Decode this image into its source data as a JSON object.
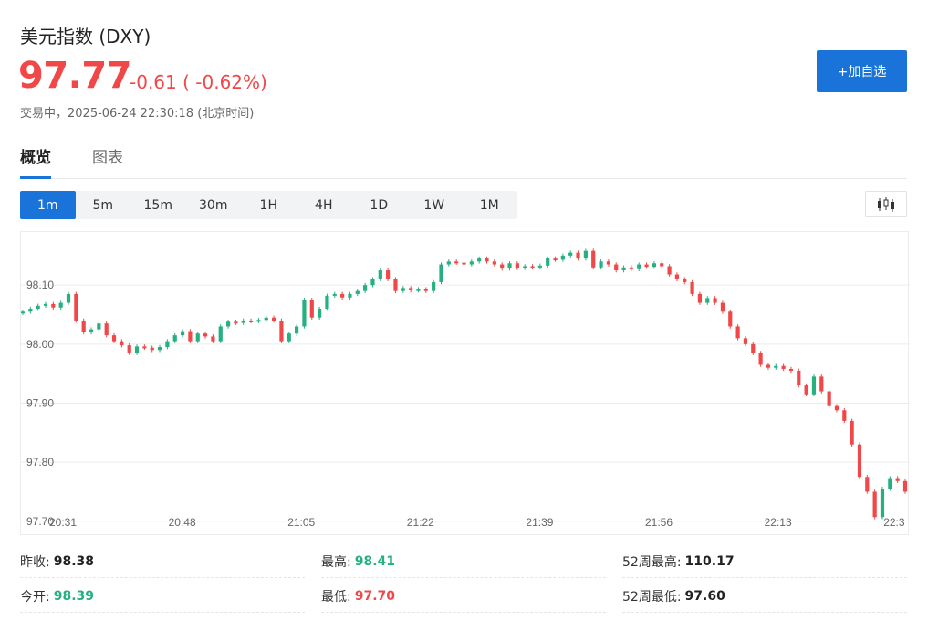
{
  "header": {
    "title": "美元指数 (DXY)",
    "price": "97.77",
    "change": "-0.61 ( -0.62%)",
    "status": "交易中，2025-06-24 22:30:18 (北京时间)",
    "add_watchlist_label": "+加自选"
  },
  "colors": {
    "up": "#26b07f",
    "down": "#f04848",
    "accent": "#1a73d9"
  },
  "tabs": [
    {
      "label": "概览",
      "active": true
    },
    {
      "label": "图表",
      "active": false
    }
  ],
  "intervals": [
    {
      "label": "1m",
      "active": true
    },
    {
      "label": "5m",
      "active": false
    },
    {
      "label": "15m",
      "active": false
    },
    {
      "label": "30m",
      "active": false
    },
    {
      "label": "1H",
      "active": false
    },
    {
      "label": "4H",
      "active": false
    },
    {
      "label": "1D",
      "active": false
    },
    {
      "label": "1W",
      "active": false
    },
    {
      "label": "1M",
      "active": false
    }
  ],
  "chart_type_icon": "candlestick-icon",
  "chart_data": {
    "type": "candlestick",
    "x_ticks": [
      "20:31",
      "20:48",
      "21:05",
      "21:22",
      "21:39",
      "21:56",
      "22:13",
      "22:3"
    ],
    "y_ticks": [
      "98.10",
      "98.00",
      "97.90",
      "97.80",
      "97.70"
    ],
    "ylim": [
      97.695,
      98.19
    ],
    "grid": true,
    "closes": [
      98.055,
      98.06,
      98.065,
      98.068,
      98.062,
      98.07,
      98.085,
      98.04,
      98.02,
      98.025,
      98.035,
      98.015,
      98.005,
      97.998,
      97.985,
      97.996,
      97.994,
      97.99,
      97.995,
      98.005,
      98.015,
      98.022,
      98.005,
      98.018,
      98.013,
      98.005,
      98.03,
      98.038,
      98.036,
      98.04,
      98.039,
      98.041,
      98.045,
      98.04,
      98.005,
      98.018,
      98.03,
      98.075,
      98.045,
      98.06,
      98.082,
      98.085,
      98.079,
      98.085,
      98.09,
      98.1,
      98.11,
      98.125,
      98.11,
      98.09,
      98.095,
      98.091,
      98.093,
      98.09,
      98.105,
      98.135,
      98.14,
      98.138,
      98.135,
      98.14,
      98.145,
      98.14,
      98.135,
      98.128,
      98.137,
      98.129,
      98.132,
      98.13,
      98.133,
      98.145,
      98.143,
      98.15,
      98.155,
      98.145,
      98.158,
      98.13,
      98.14,
      98.135,
      98.125,
      98.13,
      98.127,
      98.135,
      98.131,
      98.137,
      98.132,
      98.118,
      98.11,
      98.105,
      98.085,
      98.07,
      98.078,
      98.07,
      98.055,
      98.03,
      98.01,
      98.0,
      97.985,
      97.965,
      97.96,
      97.963,
      97.958,
      97.955,
      97.93,
      97.915,
      97.945,
      97.92,
      97.895,
      97.888,
      97.87,
      97.83,
      97.775,
      97.75,
      97.707,
      97.755,
      97.773,
      97.768,
      97.75
    ]
  },
  "stats": [
    {
      "label": "昨收:",
      "value": "98.38",
      "color": "dark"
    },
    {
      "label": "最高:",
      "value": "98.41",
      "color": "green"
    },
    {
      "label": "52周最高:",
      "value": "110.17",
      "color": "dark"
    },
    {
      "label": "今开:",
      "value": "98.39",
      "color": "green"
    },
    {
      "label": "最低:",
      "value": "97.70",
      "color": "red"
    },
    {
      "label": "52周最低:",
      "value": "97.60",
      "color": "dark"
    }
  ]
}
